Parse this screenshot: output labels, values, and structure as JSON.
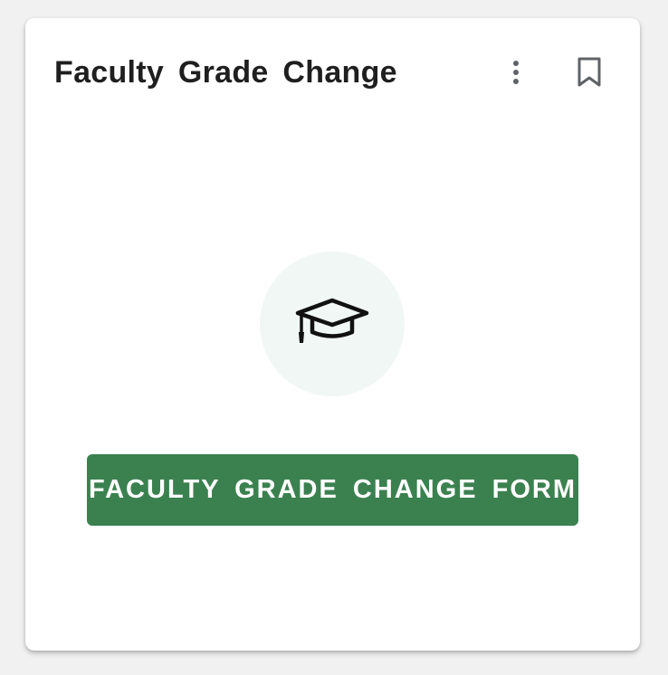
{
  "card": {
    "title": "Faculty Grade Change",
    "menu_icon": "more-vert-icon",
    "bookmark_icon": "bookmark-outline-icon",
    "hero_icon": "graduation-cap-icon",
    "button_label": "FACULTY GRADE CHANGE FORM"
  },
  "colors": {
    "accent": "#3b8150",
    "hero_circle_bg": "#f0f7f5",
    "title_text": "#1f1f1f"
  }
}
